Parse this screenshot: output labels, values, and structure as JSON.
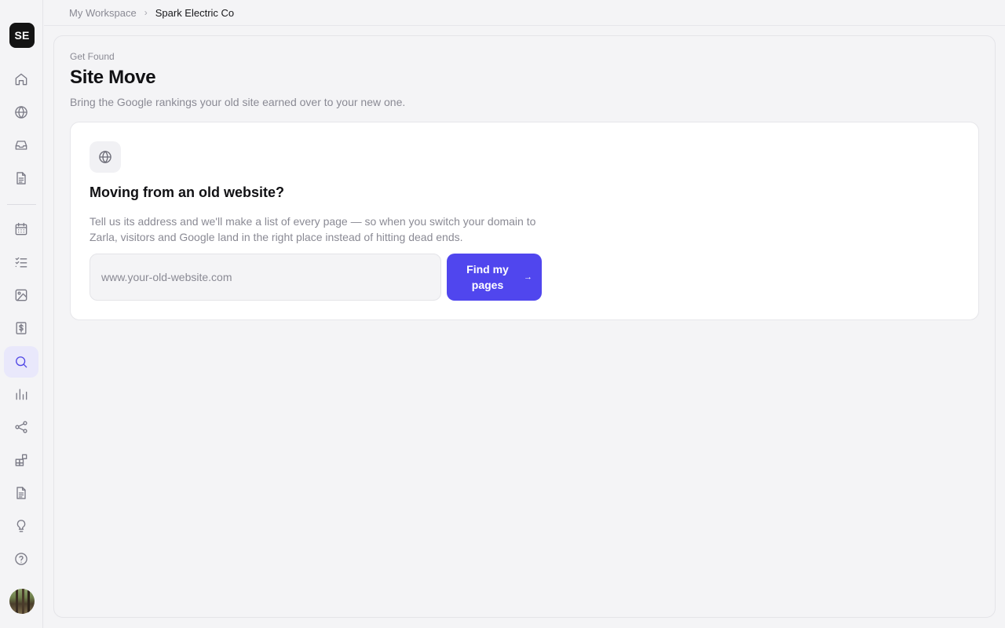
{
  "sidebar": {
    "logo_text": "SE",
    "items": [
      {
        "name": "home-icon",
        "active": false
      },
      {
        "name": "globe-icon",
        "active": false
      },
      {
        "name": "inbox-icon",
        "active": false
      },
      {
        "name": "document-icon",
        "active": false
      },
      {
        "name": "calendar-icon",
        "active": false
      },
      {
        "name": "checklist-icon",
        "active": false
      },
      {
        "name": "image-icon",
        "active": false
      },
      {
        "name": "invoice-dollar-icon",
        "active": false
      },
      {
        "name": "search-icon",
        "active": true
      },
      {
        "name": "bar-chart-icon",
        "active": false
      },
      {
        "name": "share-icon",
        "active": false
      },
      {
        "name": "apps-icon",
        "active": false
      },
      {
        "name": "page-icon",
        "active": false
      },
      {
        "name": "lightbulb-icon",
        "active": false
      },
      {
        "name": "help-icon",
        "active": false
      }
    ],
    "accent_color": "#4f46e5"
  },
  "breadcrumb": {
    "parent": "My Workspace",
    "current": "Spark Electric Co"
  },
  "page": {
    "eyebrow": "Get Found",
    "title": "Site Move",
    "subtitle": "Bring the Google rankings your old site earned over to your new one."
  },
  "card": {
    "icon": "globe-icon",
    "title": "Moving from an old website?",
    "description": "Tell us its address and we'll make a list of every page — so when you switch your domain to Zarla, visitors and Google land in the right place instead of hitting dead ends.",
    "input_placeholder": "www.your-old-website.com",
    "input_value": "",
    "button_label": "Find my pages",
    "button_arrow": "→",
    "button_color": "#5046ee"
  }
}
